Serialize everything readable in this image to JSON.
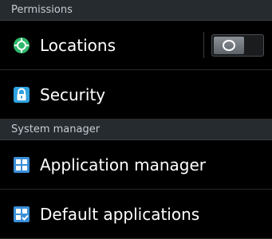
{
  "permissions": {
    "header": "Permissions",
    "items": [
      {
        "label": "Locations",
        "icon": "location-target-icon",
        "toggle": "off"
      },
      {
        "label": "Security",
        "icon": "lock-icon"
      }
    ]
  },
  "system_manager": {
    "header": "System manager",
    "items": [
      {
        "label": "Application manager",
        "icon": "app-grid-icon"
      },
      {
        "label": "Default applications",
        "icon": "app-grid-check-icon"
      }
    ]
  },
  "colors": {
    "background": "#000000",
    "header_bg": "#262b30",
    "location_green": "#2fb86b",
    "security_blue": "#2fa3e0",
    "app_blue": "#3a8fd9"
  }
}
